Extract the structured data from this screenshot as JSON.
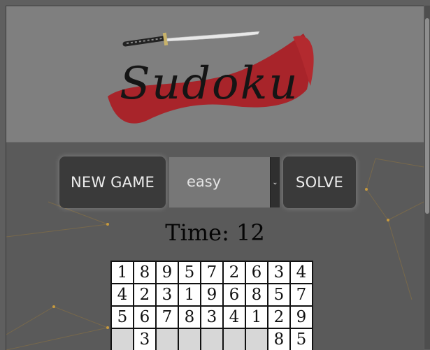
{
  "header": {
    "logo_text": "Sudoku"
  },
  "controls": {
    "new_game_label": "NEW GAME",
    "difficulty_value": "easy",
    "solve_label": "SOLVE"
  },
  "timer": {
    "text": "Time: 12"
  },
  "board": {
    "rows": [
      [
        "1",
        "8",
        "9",
        "5",
        "7",
        "2",
        "6",
        "3",
        "4"
      ],
      [
        "4",
        "2",
        "3",
        "1",
        "9",
        "6",
        "8",
        "5",
        "7"
      ],
      [
        "5",
        "6",
        "7",
        "8",
        "3",
        "4",
        "1",
        "2",
        "9"
      ],
      [
        "",
        "3",
        "",
        "",
        "",
        "",
        "",
        "8",
        "5"
      ]
    ]
  },
  "colors": {
    "header_bg": "#7f7f7f",
    "logo_red": "#a8242a",
    "button_bg": "#3a3a3a",
    "empty_cell": "#d7d7d7",
    "bg_line": "#b08a3a"
  }
}
